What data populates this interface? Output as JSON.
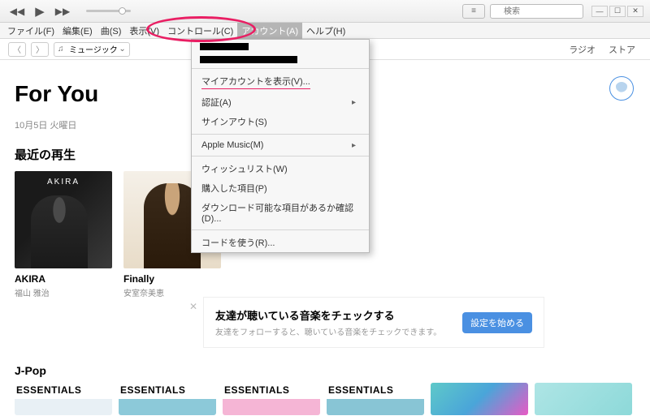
{
  "titlebar": {
    "search_placeholder": "検索"
  },
  "menubar": {
    "items": [
      "ファイル(F)",
      "編集(E)",
      "曲(S)",
      "表示(V)",
      "コントロール(C)",
      "アカウント(A)",
      "ヘルプ(H)"
    ],
    "active_index": 5
  },
  "nav": {
    "dropdown": "ミュージック",
    "links": [
      "ラジオ",
      "ストア"
    ]
  },
  "page": {
    "title": "For You",
    "date": "10月5日 火曜日",
    "section1": "最近の再生"
  },
  "albums": [
    {
      "art_label": "AKIRA",
      "title": "AKIRA",
      "artist": "福山 雅治"
    },
    {
      "art_label": "",
      "title": "Finally",
      "artist": "安室奈美恵"
    }
  ],
  "account_menu": {
    "show_account": "マイアカウントを表示(V)...",
    "auth": "認証(A)",
    "signout": "サインアウト(S)",
    "apple_music": "Apple Music(M)",
    "wishlist": "ウィッシュリスト(W)",
    "purchased": "購入した項目(P)",
    "check_downloads": "ダウンロード可能な項目があるか確認(D)...",
    "redeem": "コードを使う(R)..."
  },
  "promo": {
    "title": "友達が聴いている音楽をチェックする",
    "subtitle": "友達をフォローすると、聴いている音楽をチェックできます。",
    "button": "設定を始める"
  },
  "jpop": {
    "heading": "J-Pop",
    "tile_label": "ESSENTIALS"
  }
}
